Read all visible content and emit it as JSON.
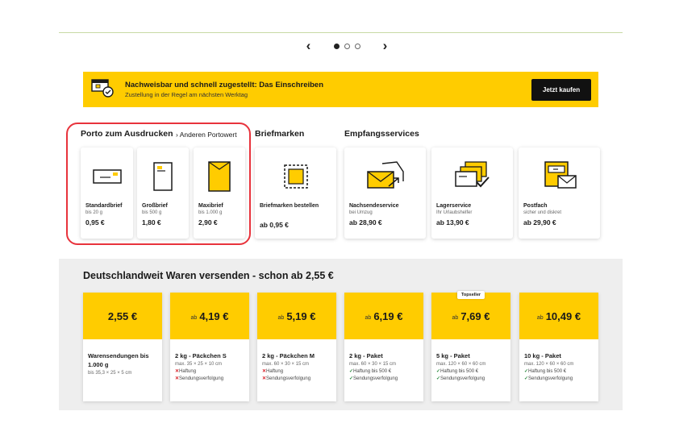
{
  "carousel": {
    "prev": "‹",
    "next": "›",
    "active_index": 0,
    "dot_count": 3
  },
  "banner": {
    "title": "Nachweisbar und schnell zugestellt: Das Einschreiben",
    "subtitle": "Zustellung in der Regel am nächsten Werktag",
    "button": "Jetzt kaufen",
    "icon": "registered-letter-icon"
  },
  "sections": {
    "porto": {
      "title": "Porto zum Ausdrucken",
      "link": "› Anderen Portowert"
    },
    "briefmarken": {
      "title": "Briefmarken"
    },
    "empfang": {
      "title": "Empfangsservices"
    }
  },
  "cards": [
    {
      "name": "Standardbrief",
      "sub": "bis 20 g",
      "price": "0,95 €",
      "icon": "standard-letter-icon"
    },
    {
      "name": "Großbrief",
      "sub": "bis 500 g",
      "price": "1,80 €",
      "icon": "large-letter-icon"
    },
    {
      "name": "Maxibrief",
      "sub": "bis 1.000 g",
      "price": "2,90 €",
      "icon": "maxi-letter-icon"
    },
    {
      "name": "Briefmarken bestellen",
      "sub": "",
      "price": "ab 0,95 €",
      "icon": "stamp-icon"
    },
    {
      "name": "Nachsendeservice",
      "sub": "bei Umzug",
      "price": "ab 28,90 €",
      "icon": "forwarding-icon"
    },
    {
      "name": "Lagerservice",
      "sub": "Ihr Urlaubshelfer",
      "price": "ab 13,90 €",
      "icon": "storage-icon"
    },
    {
      "name": "Postfach",
      "sub": "sicher und diskret",
      "price": "ab 29,90 €",
      "icon": "mailbox-icon"
    }
  ],
  "parcels": {
    "title": "Deutschlandweit Waren versenden - schon ab 2,55 €",
    "items": [
      {
        "ab": "",
        "price": "2,55 €",
        "badge": "",
        "name": "Warensendungen bis 1.000 g",
        "dims": "bis 35,3 × 25 × 5 cm",
        "features": []
      },
      {
        "ab": "ab",
        "price": "4,19 €",
        "badge": "",
        "name": "2 kg - Päckchen S",
        "dims": "max. 35 × 25 × 10 cm",
        "features": [
          {
            "ok": false,
            "label": "Haftung"
          },
          {
            "ok": false,
            "label": "Sendungsverfolgung"
          }
        ]
      },
      {
        "ab": "ab",
        "price": "5,19 €",
        "badge": "",
        "name": "2 kg - Päckchen M",
        "dims": "max. 60 × 30 × 15 cm",
        "features": [
          {
            "ok": false,
            "label": "Haftung"
          },
          {
            "ok": false,
            "label": "Sendungsverfolgung"
          }
        ]
      },
      {
        "ab": "ab",
        "price": "6,19 €",
        "badge": "",
        "name": "2 kg - Paket",
        "dims": "max. 60 × 30 × 15 cm",
        "features": [
          {
            "ok": true,
            "label": "Haftung bis 500 €"
          },
          {
            "ok": true,
            "label": "Sendungsverfolgung"
          }
        ]
      },
      {
        "ab": "ab",
        "price": "7,69 €",
        "badge": "Topseller",
        "name": "5 kg - Paket",
        "dims": "max. 120 × 60 × 60 cm",
        "features": [
          {
            "ok": true,
            "label": "Haftung bis 500 €"
          },
          {
            "ok": true,
            "label": "Sendungsverfolgung"
          }
        ]
      },
      {
        "ab": "ab",
        "price": "10,49 €",
        "badge": "",
        "name": "10 kg - Paket",
        "dims": "max. 120 × 60 × 60 cm",
        "features": [
          {
            "ok": true,
            "label": "Haftung bis 500 €"
          },
          {
            "ok": true,
            "label": "Sendungsverfolgung"
          }
        ]
      }
    ]
  },
  "colors": {
    "brand_yellow": "#ffcc00",
    "highlight_red": "#e8333c",
    "ok_green": "#2a8a3e",
    "x_red": "#d8232a"
  }
}
